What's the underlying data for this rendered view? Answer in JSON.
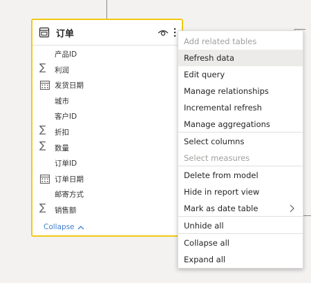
{
  "table": {
    "title": "订单",
    "fields": [
      {
        "icon": "none",
        "label": "产品ID"
      },
      {
        "icon": "sigma-icon",
        "label": "利润"
      },
      {
        "icon": "calendar-icon",
        "label": "发货日期"
      },
      {
        "icon": "none",
        "label": "城市"
      },
      {
        "icon": "none",
        "label": "客户ID"
      },
      {
        "icon": "sigma-icon",
        "label": "折扣"
      },
      {
        "icon": "sigma-icon",
        "label": "数量"
      },
      {
        "icon": "none",
        "label": "订单ID"
      },
      {
        "icon": "calendar-icon",
        "label": "订单日期"
      },
      {
        "icon": "none",
        "label": "邮寄方式"
      },
      {
        "icon": "sigma-icon",
        "label": "销售额"
      }
    ],
    "collapse_label": "Collapse"
  },
  "menu": {
    "items": [
      {
        "label": "Add related tables",
        "disabled": true
      },
      {
        "label": "Refresh data",
        "hover": true
      },
      {
        "label": "Edit query"
      },
      {
        "label": "Manage relationships"
      },
      {
        "label": "Incremental refresh"
      },
      {
        "label": "Manage aggregations"
      },
      {
        "label": "Select columns"
      },
      {
        "label": "Select measures",
        "disabled": true
      },
      {
        "label": "Delete from model"
      },
      {
        "label": "Hide in report view"
      },
      {
        "label": "Mark as date table",
        "submenu": true
      },
      {
        "label": "Unhide all"
      },
      {
        "label": "Collapse all"
      },
      {
        "label": "Expand all"
      }
    ]
  },
  "colors": {
    "selection_border": "#f2c811",
    "link": "#3f7fcc",
    "hover_bg": "#edebe9"
  }
}
